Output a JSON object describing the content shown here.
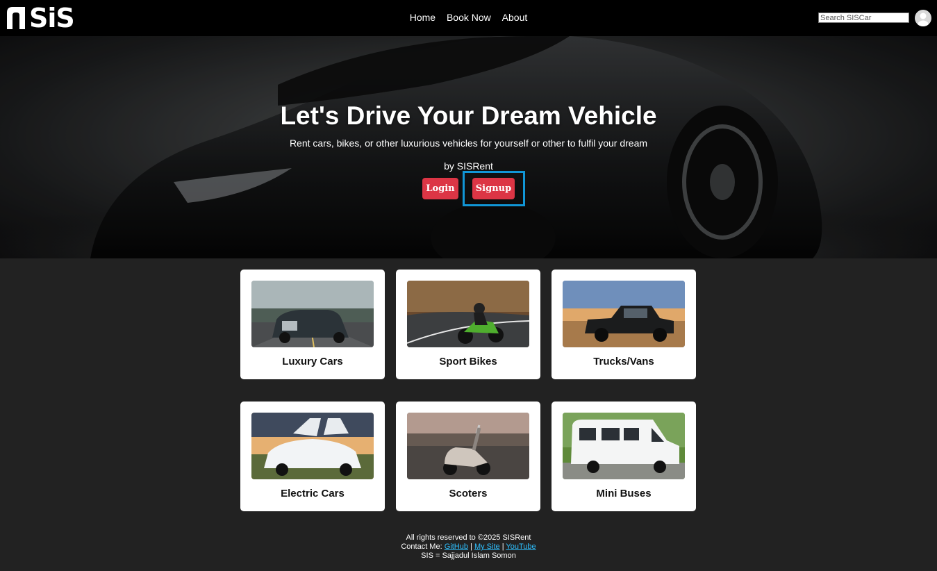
{
  "brand": {
    "logo_text": "SiS"
  },
  "nav": {
    "items": [
      "Home",
      "Book Now",
      "About"
    ]
  },
  "search": {
    "placeholder": "Search SISCar"
  },
  "hero": {
    "title": "Let's Drive Your Dream Vehicle",
    "subtitle": "Rent cars, bikes, or other luxurious vehicles for yourself or other to fulfil your dream",
    "byline": "by SISRent",
    "login_label": "Login",
    "signup_label": "Signup"
  },
  "categories": [
    {
      "label": "Luxury Cars"
    },
    {
      "label": "Sport Bikes"
    },
    {
      "label": "Trucks/Vans"
    },
    {
      "label": "Electric Cars"
    },
    {
      "label": "Scoters"
    },
    {
      "label": "Mini Buses"
    }
  ],
  "footer": {
    "rights": "All rights reserved to ©2025 SISRent",
    "contact_prefix": "Contact Me:",
    "links": [
      "GitHub",
      "My Site",
      "YouTube"
    ],
    "separator": "|",
    "acronym": "SIS = Sajjadul Islam Somon"
  },
  "colors": {
    "accent": "#dc3545",
    "highlight": "#1196d6",
    "link": "#2ec0ff",
    "page_bg": "#222222"
  }
}
